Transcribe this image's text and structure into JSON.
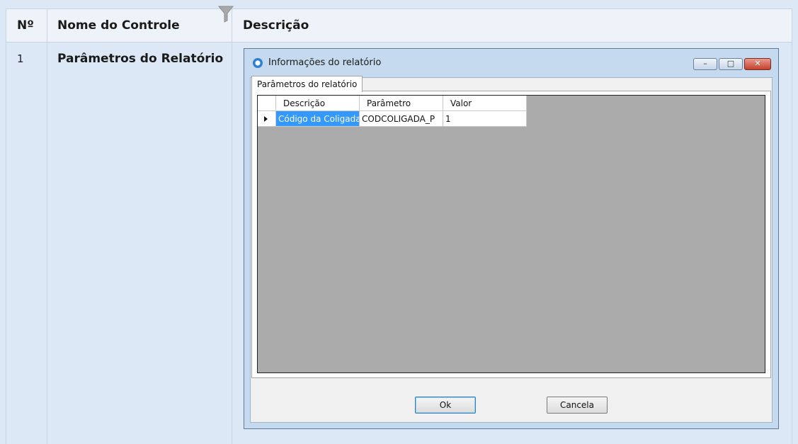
{
  "table": {
    "headers": {
      "num": "Nº",
      "name": "Nome do Controle",
      "desc": "Descrição"
    },
    "row": {
      "num": "1",
      "name": "Parâmetros do Relatório"
    }
  },
  "dialog": {
    "title": "Informações do relatório",
    "tab_label": "Parâmetros do relatório",
    "grid": {
      "columns": [
        "Descrição",
        "Parâmetro",
        "Valor"
      ],
      "rows": [
        [
          "Código da Coligada",
          "CODCOLIGADA_P",
          "1"
        ]
      ]
    },
    "ok_label": "Ok",
    "cancel_label": "Cancela"
  }
}
